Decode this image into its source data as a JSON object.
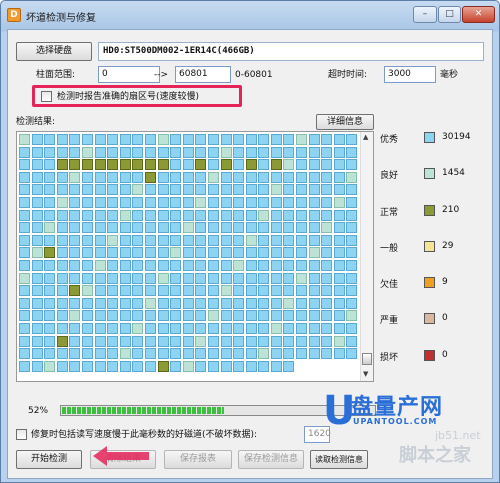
{
  "window": {
    "title": "坏道检测与修复",
    "icon_letter": "D",
    "minimize_glyph": "–",
    "maximize_glyph": "□",
    "close_glyph": "✕"
  },
  "disk": {
    "select_button": "选择硬盘",
    "disk_name": "HD0:ST500DM002-1ER14C(466GB)"
  },
  "cylinder": {
    "label": "柱面范围:",
    "from": "0",
    "arrow": "-->",
    "to": "60801",
    "range_hint": "0-60801"
  },
  "timeout": {
    "label": "超时时间:",
    "value": "3000",
    "unit": "毫秒"
  },
  "options": {
    "report_sector_label": "检测时报告准确的扇区号(速度较慢)",
    "repair_label": "修复时包括读写速度慢于此毫秒数的好磁道(不破坏数据):",
    "repair_value": "1620"
  },
  "results": {
    "label": "检测结果:",
    "detail_button": "详细信息"
  },
  "legend": [
    {
      "label": "优秀",
      "color": "#8dd3f2",
      "count": "30194"
    },
    {
      "label": "良好",
      "color": "#bde3d6",
      "count": "1454"
    },
    {
      "label": "正常",
      "color": "#8c9a35",
      "count": "210"
    },
    {
      "label": "一般",
      "color": "#f3e49a",
      "count": "29"
    },
    {
      "label": "欠佳",
      "color": "#f0a020",
      "count": "9"
    },
    {
      "label": "严重",
      "color": "#d8b8a0",
      "count": "0"
    },
    {
      "label": "损坏",
      "color": "#c03030",
      "count": "0"
    }
  ],
  "progress": {
    "percent_text": "52%",
    "fraction": 0.52
  },
  "buttons": {
    "start": "开始检测",
    "clear": "清除结果",
    "save_report": "保存报表",
    "save_info": "保存检测信息",
    "read_info": "读取检测信息"
  },
  "watermark": {
    "big": "盘量产网",
    "small": "UPANTOOL.COM",
    "site": "jb51.net",
    "brand": "脚本之家"
  }
}
